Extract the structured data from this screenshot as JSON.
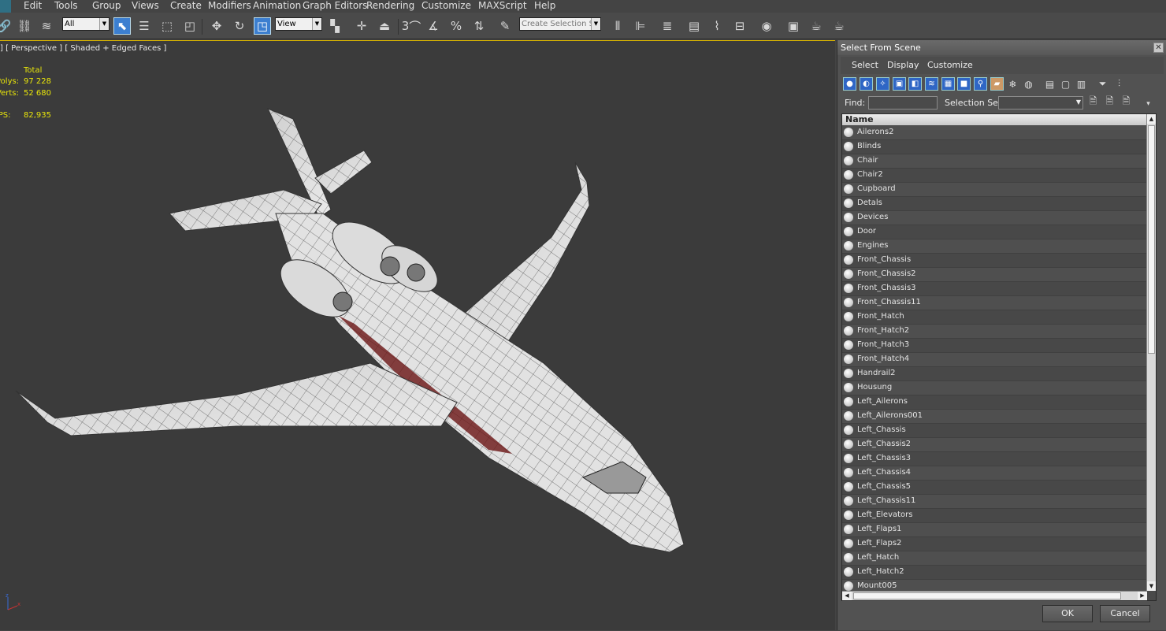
{
  "menu": [
    "Edit",
    "Tools",
    "Group",
    "Views",
    "Create",
    "Modifiers",
    "Animation",
    "Graph Editors",
    "Rendering",
    "Customize",
    "MAXScript",
    "Help"
  ],
  "toolbar": {
    "filter_value": "All",
    "refcoord_value": "View",
    "selection_set_placeholder": "Create Selection Se",
    "snap_label": "3"
  },
  "viewport": {
    "label": "] [ Perspective ] [ Shaded + Edged Faces ]",
    "stats": {
      "total_label": "Total",
      "polys_label": "Polys:",
      "polys_value": "97 228",
      "verts_label": "Verts:",
      "verts_value": "52 680",
      "fps_label": "FPS:",
      "fps_value": "82,935"
    },
    "axis_x": "x",
    "axis_z": "z"
  },
  "dialog": {
    "title": "Select From Scene",
    "menu": [
      "Select",
      "Display",
      "Customize"
    ],
    "find_label": "Find:",
    "find_value": "",
    "selection_set_label": "Selection Set:",
    "column_name": "Name",
    "items": [
      "Ailerons2",
      "Blinds",
      "Chair",
      "Chair2",
      "Cupboard",
      "Detals",
      "Devices",
      "Door",
      "Engines",
      "Front_Chassis",
      "Front_Chassis2",
      "Front_Chassis3",
      "Front_Chassis11",
      "Front_Hatch",
      "Front_Hatch2",
      "Front_Hatch3",
      "Front_Hatch4",
      "Handrail2",
      "Housung",
      "Left_Ailerons",
      "Left_Ailerons001",
      "Left_Chassis",
      "Left_Chassis2",
      "Left_Chassis3",
      "Left_Chassis4",
      "Left_Chassis5",
      "Left_Chassis11",
      "Left_Elevators",
      "Left_Flaps1",
      "Left_Flaps2",
      "Left_Hatch",
      "Left_Hatch2",
      "Mount005"
    ],
    "ok_label": "OK",
    "cancel_label": "Cancel"
  },
  "colors": {
    "viewport_bg": "#3b3b3b",
    "stats_yellow": "#e9e60a",
    "selection_blue": "#3c7fd0"
  }
}
